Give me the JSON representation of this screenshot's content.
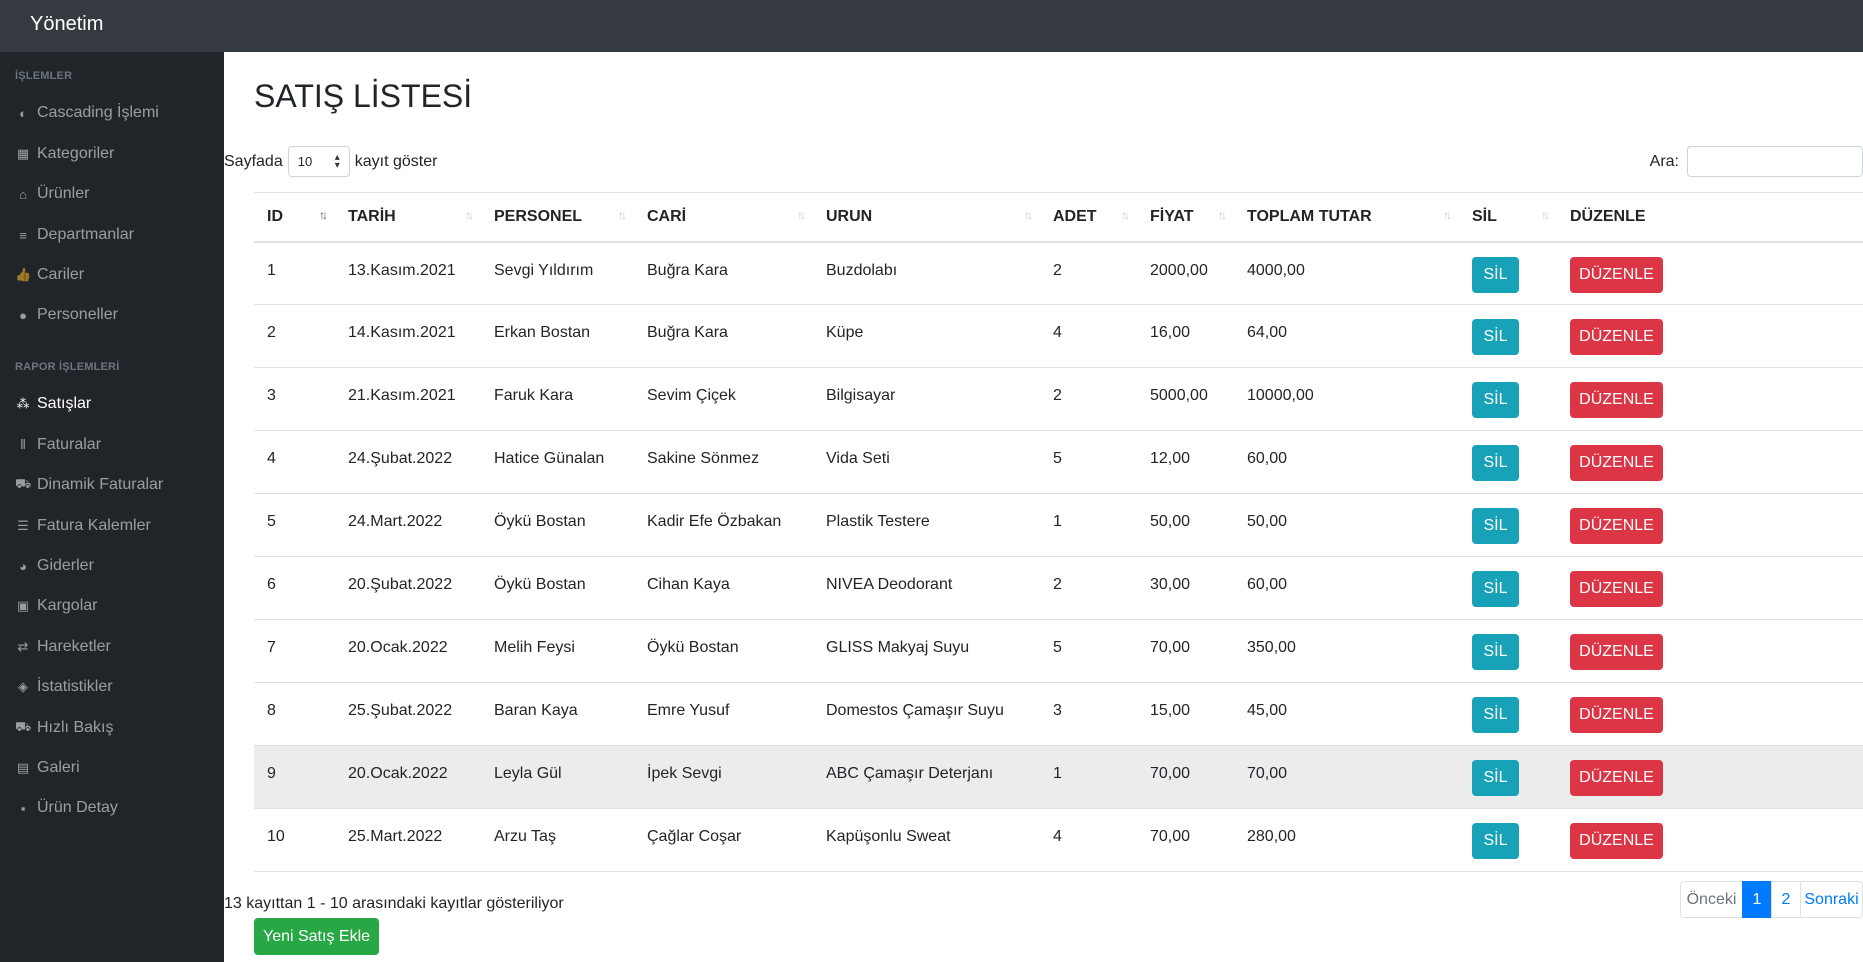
{
  "brand": "Yönetim",
  "sidebar": {
    "heading1": "İŞLEMLER",
    "heading2": "RAPOR İŞLEMLERİ",
    "items": [
      {
        "label": "Cascading İşlemi",
        "icon": "half-circle-icon",
        "glyph": "◐"
      },
      {
        "label": "Kategoriler",
        "icon": "grid-icon",
        "glyph": "▦"
      },
      {
        "label": "Ürünler",
        "icon": "hdd-icon",
        "glyph": "⌂"
      },
      {
        "label": "Departmanlar",
        "icon": "list-icon",
        "glyph": "≡"
      },
      {
        "label": "Cariler",
        "icon": "thumbs-up-icon",
        "glyph": "👍"
      },
      {
        "label": "Personeller",
        "icon": "user-icon",
        "glyph": "●"
      },
      {
        "label": "Satışlar",
        "icon": "cubes-icon",
        "glyph": "⁂"
      },
      {
        "label": "Faturalar",
        "icon": "barcode-icon",
        "glyph": "⦀"
      },
      {
        "label": "Dinamik Faturalar",
        "icon": "bed-icon",
        "glyph": "⛟"
      },
      {
        "label": "Fatura Kalemler",
        "icon": "list-ul-icon",
        "glyph": "☰"
      },
      {
        "label": "Giderler",
        "icon": "pie-chart-icon",
        "glyph": "◕"
      },
      {
        "label": "Kargolar",
        "icon": "briefcase-icon",
        "glyph": "▣"
      },
      {
        "label": "Hareketler",
        "icon": "arrows-icon",
        "glyph": "⇄"
      },
      {
        "label": "İstatistikler",
        "icon": "tags-icon",
        "glyph": "◈"
      },
      {
        "label": "Hızlı Bakış",
        "icon": "truck-icon",
        "glyph": "⛟"
      },
      {
        "label": "Galeri",
        "icon": "gas-pump-icon",
        "glyph": "▤"
      },
      {
        "label": "Ürün Detay",
        "icon": "detail-icon",
        "glyph": "▪"
      }
    ]
  },
  "page": {
    "title": "SATIŞ LİSTESİ",
    "length_prefix": "Sayfada",
    "length_value": "10",
    "length_suffix": "kayıt göster",
    "search_label": "Ara:",
    "info": "13 kayıttan 1 - 10 arasındaki kayıtlar gösteriliyor",
    "new_button": "Yeni Satış Ekle"
  },
  "table": {
    "headers": [
      "ID",
      "TARİH",
      "PERSONEL",
      "CARİ",
      "URUN",
      "ADET",
      "FİYAT",
      "TOPLAM TUTAR",
      "SİL",
      "DÜZENLE"
    ],
    "sil_label": "SİL",
    "duzenle_label": "DÜZENLE",
    "rows": [
      [
        "1",
        "13.Kasım.2021",
        "Sevgi Yıldırım",
        "Buğra Kara",
        "Buzdolabı",
        "2",
        "2000,00",
        "4000,00"
      ],
      [
        "2",
        "14.Kasım.2021",
        "Erkan Bostan",
        "Buğra Kara",
        "Küpe",
        "4",
        "16,00",
        "64,00"
      ],
      [
        "3",
        "21.Kasım.2021",
        "Faruk Kara",
        "Sevim Çiçek",
        "Bilgisayar",
        "2",
        "5000,00",
        "10000,00"
      ],
      [
        "4",
        "24.Şubat.2022",
        "Hatice Günalan",
        "Sakine Sönmez",
        "Vida Seti",
        "5",
        "12,00",
        "60,00"
      ],
      [
        "5",
        "24.Mart.2022",
        "Öykü Bostan",
        "Kadir Efe Özbakan",
        "Plastik Testere",
        "1",
        "50,00",
        "50,00"
      ],
      [
        "6",
        "20.Şubat.2022",
        "Öykü Bostan",
        "Cihan Kaya",
        "NIVEA Deodorant",
        "2",
        "30,00",
        "60,00"
      ],
      [
        "7",
        "20.Ocak.2022",
        "Melih Feysi",
        "Öykü Bostan",
        "GLISS Makyaj Suyu",
        "5",
        "70,00",
        "350,00"
      ],
      [
        "8",
        "25.Şubat.2022",
        "Baran Kaya",
        "Emre Yusuf",
        "Domestos Çamaşır Suyu",
        "3",
        "15,00",
        "45,00"
      ],
      [
        "9",
        "20.Ocak.2022",
        "Leyla Gül",
        "İpek Sevgi",
        "ABC Çamaşır Deterjanı",
        "1",
        "70,00",
        "70,00"
      ],
      [
        "10",
        "25.Mart.2022",
        "Arzu Taş",
        "Çağlar Coşar",
        "Kapüşonlu Sweat",
        "4",
        "70,00",
        "280,00"
      ]
    ]
  },
  "pagination": {
    "prev": "Önceki",
    "pages": [
      "1",
      "2"
    ],
    "next": "Sonraki"
  }
}
